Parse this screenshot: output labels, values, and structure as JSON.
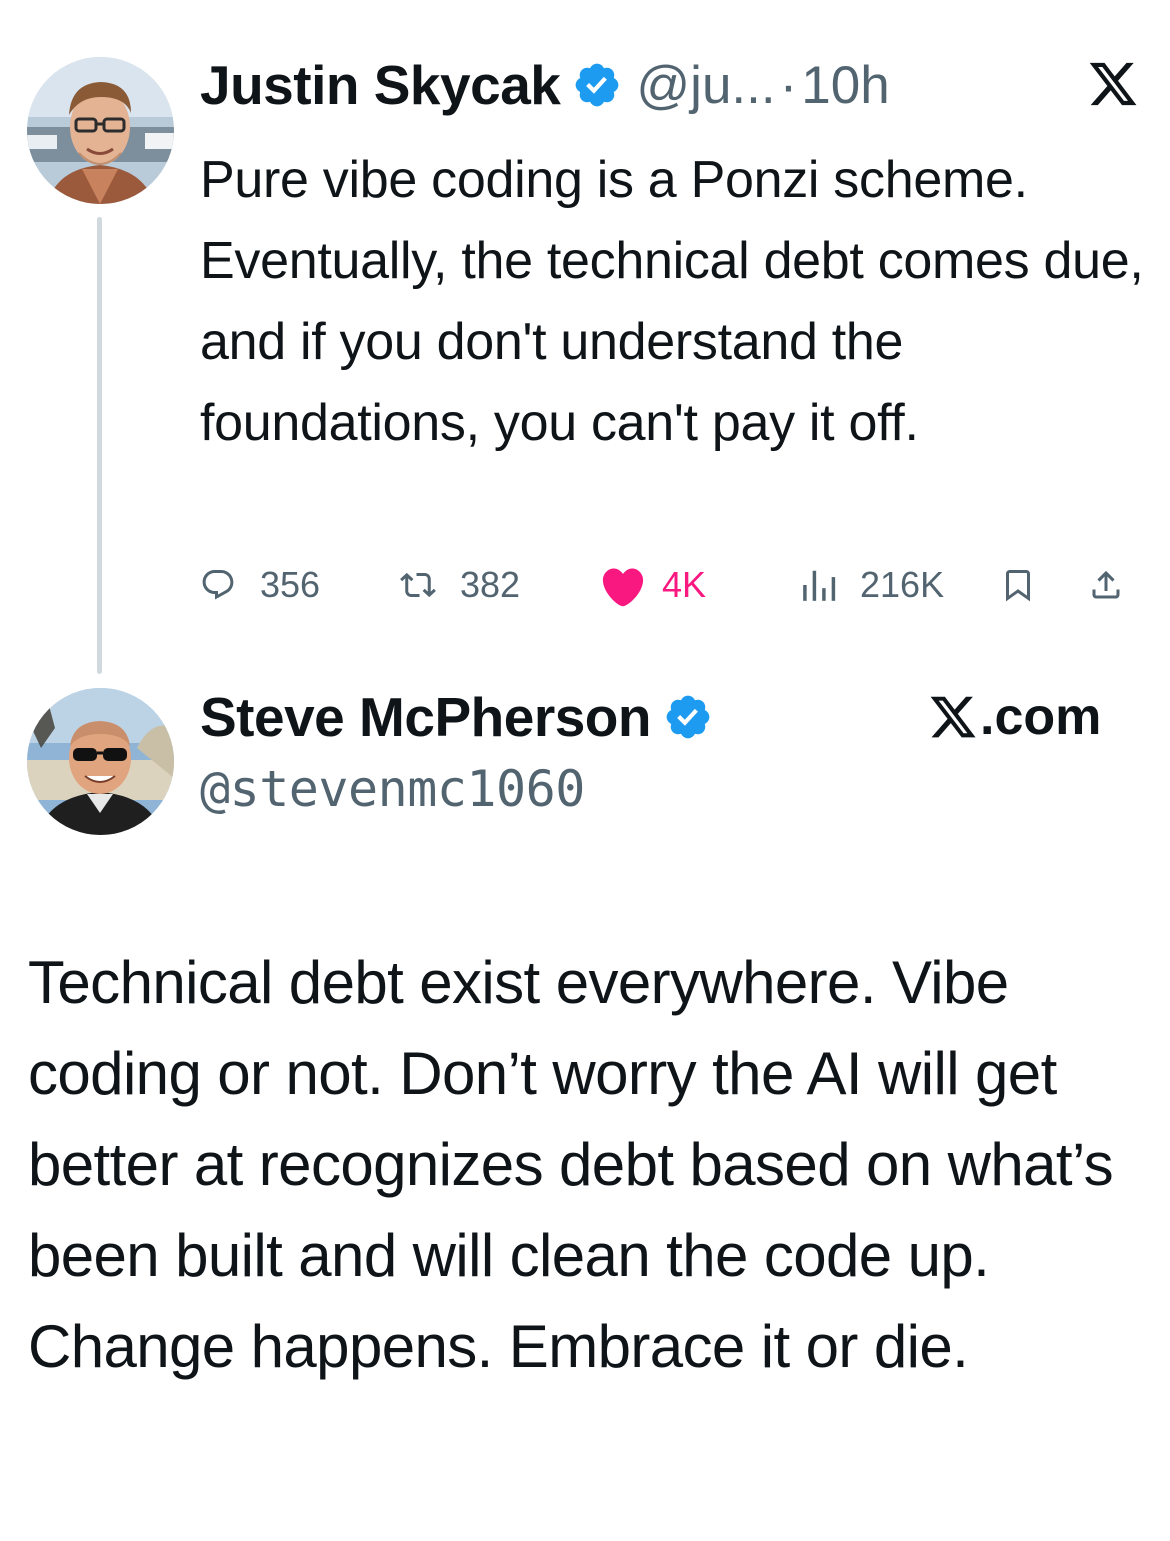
{
  "tweet": {
    "author": {
      "display_name": "Justin Skycak",
      "handle": "@ju...",
      "verified": true
    },
    "separator": "·",
    "time": "10h",
    "text": "Pure vibe coding is a Ponzi scheme. Eventually, the technical debt comes due, and if you don't understand the foundations, you can't pay it off.",
    "stats": {
      "replies": "356",
      "reposts": "382",
      "likes": "4K",
      "views": "216K"
    },
    "liked": true
  },
  "reply": {
    "author": {
      "display_name": "Steve McPherson",
      "handle": "@stevenmc1060",
      "verified": true
    },
    "source_label": ".com",
    "text": "Technical debt exist everywhere. Vibe coding or not. Don’t worry the AI will get better at recognizes debt based on what’s been built and will clean the code up. Change happens. Embrace it or die."
  },
  "icons": {
    "logo": "x-logo-icon",
    "verified": "verified-badge-icon",
    "reply": "reply-icon",
    "repost": "repost-icon",
    "like": "heart-icon",
    "views": "views-icon",
    "bookmark": "bookmark-icon",
    "share": "share-icon"
  },
  "colors": {
    "text_primary": "#0f1419",
    "text_secondary": "#536471",
    "verified_blue": "#1d9bf0",
    "like_pink": "#f91880",
    "thread_line": "#cfd9de"
  }
}
